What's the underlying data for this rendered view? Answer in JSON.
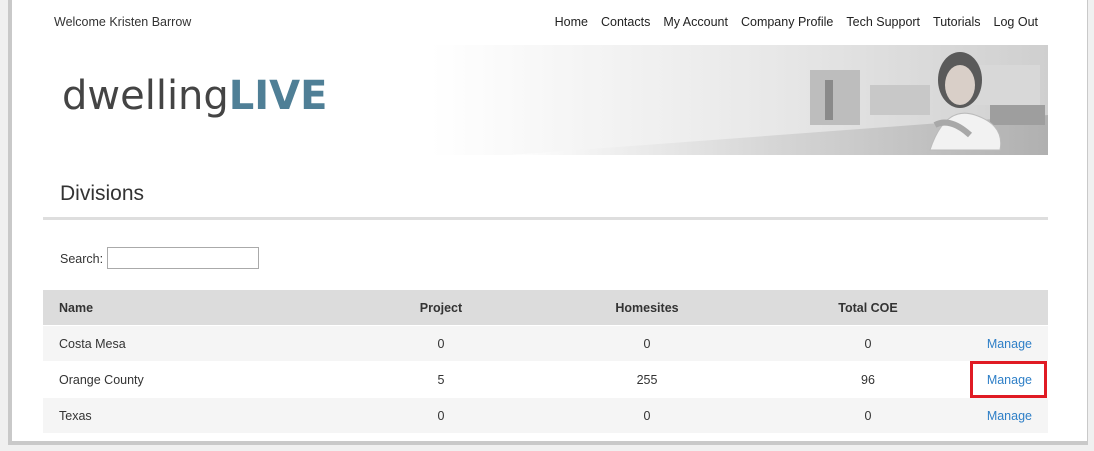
{
  "header": {
    "welcome": "Welcome Kristen Barrow",
    "nav": [
      "Home",
      "Contacts",
      "My Account",
      "Company Profile",
      "Tech Support",
      "Tutorials",
      "Log Out"
    ]
  },
  "logo": {
    "part1": "dwelling",
    "part2": "LIVE"
  },
  "page": {
    "title": "Divisions"
  },
  "search": {
    "label": "Search:",
    "value": ""
  },
  "table": {
    "columns": [
      "Name",
      "Project",
      "Homesites",
      "Total COE",
      ""
    ],
    "rows": [
      {
        "name": "Costa Mesa",
        "project": "0",
        "homesites": "0",
        "total_coe": "0",
        "action": "Manage"
      },
      {
        "name": "Orange County",
        "project": "5",
        "homesites": "255",
        "total_coe": "96",
        "action": "Manage"
      },
      {
        "name": "Texas",
        "project": "0",
        "homesites": "0",
        "total_coe": "0",
        "action": "Manage"
      }
    ]
  },
  "colors": {
    "accent": "#2e7fc7",
    "logo_accent": "#4f7f96",
    "highlight": "#e01b24"
  }
}
